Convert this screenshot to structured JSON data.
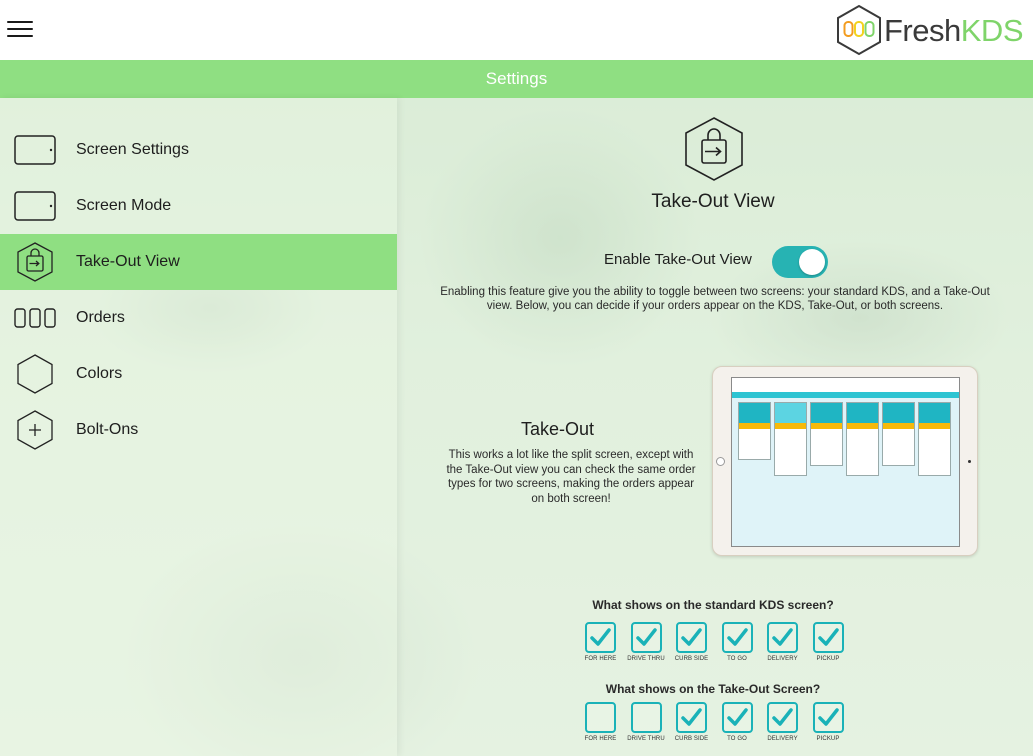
{
  "header": {
    "menu_icon": "hamburger-menu-icon",
    "logo": {
      "brand_first": "Fresh",
      "brand_second": "KDS"
    }
  },
  "settings_bar": {
    "title": "Settings"
  },
  "sidebar": {
    "items": [
      {
        "label": "Screen Settings",
        "icon": "tablet-icon",
        "active": false
      },
      {
        "label": "Screen Mode",
        "icon": "tablet-icon",
        "active": false
      },
      {
        "label": "Take-Out View",
        "icon": "takeout-bag-icon",
        "active": true
      },
      {
        "label": "Orders",
        "icon": "orders-columns-icon",
        "active": false
      },
      {
        "label": "Colors",
        "icon": "hexagon-icon",
        "active": false
      },
      {
        "label": "Bolt-Ons",
        "icon": "plus-hexagon-icon",
        "active": false
      }
    ]
  },
  "content": {
    "title": "Take-Out View",
    "enable_label": "Enable Take-Out View",
    "enable_on": true,
    "description": "Enabling this feature give you the ability to toggle between two screens: your standard KDS, and a Take-Out view. Below, you can decide if your orders appear on the KDS, Take-Out, or both screens.",
    "takeout": {
      "heading": "Take-Out",
      "text": "This works a lot like the split screen, except with the Take-Out view you can check the same order types for two screens, making the orders appear on both screen!"
    },
    "standard_question": "What shows on the standard KDS screen?",
    "takeout_question": "What shows on the Take-Out Screen?",
    "standard_options": [
      {
        "label": "FOR HERE",
        "checked": true
      },
      {
        "label": "DRIVE THRU",
        "checked": true
      },
      {
        "label": "CURB SIDE",
        "checked": true
      },
      {
        "label": "TO GO",
        "checked": true
      },
      {
        "label": "DELIVERY",
        "checked": true
      },
      {
        "label": "PICKUP",
        "checked": true
      }
    ],
    "takeout_options": [
      {
        "label": "FOR HERE",
        "checked": false
      },
      {
        "label": "DRIVE THRU",
        "checked": false
      },
      {
        "label": "CURB SIDE",
        "checked": true
      },
      {
        "label": "TO GO",
        "checked": true
      },
      {
        "label": "DELIVERY",
        "checked": true
      },
      {
        "label": "PICKUP",
        "checked": true
      }
    ]
  },
  "colors": {
    "green": "#8fdf82",
    "teal": "#1ab2b8",
    "toggle_on": "#27b3b3",
    "logo_dot_orange": "#f39c1f",
    "logo_dot_yellow": "#f3d21f",
    "logo_dot_green": "#7fd46a"
  }
}
